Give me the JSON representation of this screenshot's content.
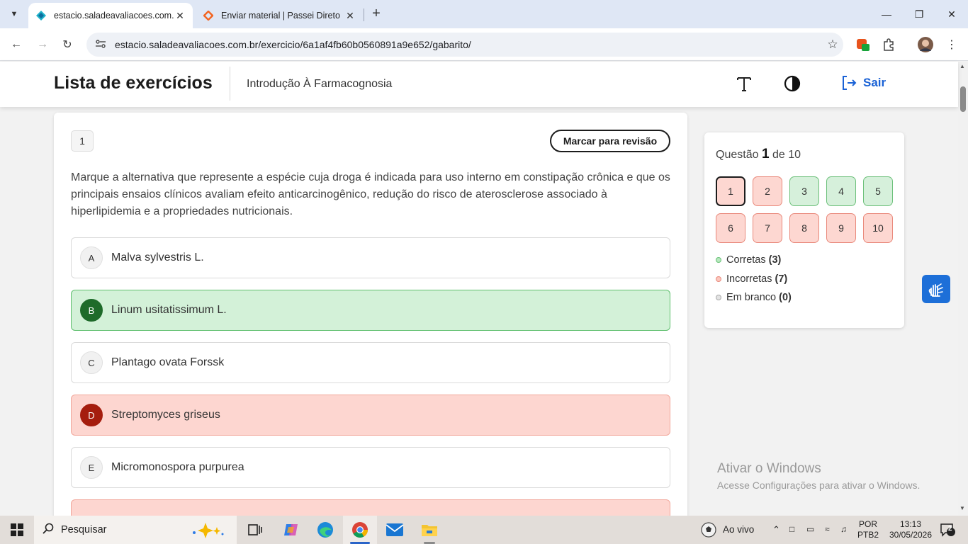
{
  "browser": {
    "tabs": [
      {
        "title": "estacio.saladeavaliacoes.com.br",
        "active": true
      },
      {
        "title": "Enviar material | Passei Direto",
        "active": false
      }
    ],
    "url": "estacio.saladeavaliacoes.com.br/exercicio/6a1af4fb60b0560891a9e652/gabarito/"
  },
  "header": {
    "title": "Lista de exercícios",
    "course": "Introdução À Farmacognosia",
    "logout_label": "Sair"
  },
  "question": {
    "number": "1",
    "review_button": "Marcar para revisão",
    "text": "Marque a alternativa que represente a espécie cuja droga é indicada para uso interno em constipação crônica e que os principais ensaios clínicos avaliam efeito anticarcinogênico, redução do risco de aterosclerose associado à hiperlipidemia e a propriedades nutricionais.",
    "options": [
      {
        "letter": "A",
        "text": "Malva sylvestris L.",
        "status": "neutral"
      },
      {
        "letter": "B",
        "text": "Linum usitatissimum L.",
        "status": "correct"
      },
      {
        "letter": "C",
        "text": "Plantago ovata Forssk",
        "status": "neutral"
      },
      {
        "letter": "D",
        "text": "Streptomyces griseus",
        "status": "wrong"
      },
      {
        "letter": "E",
        "text": "Micromonospora purpurea",
        "status": "neutral"
      }
    ]
  },
  "navigator": {
    "label_prefix": "Questão",
    "current": "1",
    "label_suffix": "de 10",
    "questions": [
      {
        "n": "1",
        "status": "incorrect"
      },
      {
        "n": "2",
        "status": "incorrect"
      },
      {
        "n": "3",
        "status": "correct"
      },
      {
        "n": "4",
        "status": "correct"
      },
      {
        "n": "5",
        "status": "correct"
      },
      {
        "n": "6",
        "status": "incorrect"
      },
      {
        "n": "7",
        "status": "incorrect"
      },
      {
        "n": "8",
        "status": "incorrect"
      },
      {
        "n": "9",
        "status": "incorrect"
      },
      {
        "n": "10",
        "status": "incorrect"
      }
    ],
    "legend": {
      "correct_label": "Corretas",
      "correct_count": "(3)",
      "incorrect_label": "Incorretas",
      "incorrect_count": "(7)",
      "blank_label": "Em branco",
      "blank_count": "(0)"
    }
  },
  "watermark": {
    "line1": "Ativar o Windows",
    "line2": "Acesse Configurações para ativar o Windows."
  },
  "taskbar": {
    "search_placeholder": "Pesquisar",
    "weather_label": "Ao vivo",
    "lang_line1": "POR",
    "lang_line2": "PTB2",
    "time": "13:13",
    "date": "30/05/2026",
    "notification_count": "2"
  },
  "colors": {
    "accent": "#1a62d6",
    "correct_bg": "#d3f1d8",
    "wrong_bg": "#fdd6d0"
  }
}
